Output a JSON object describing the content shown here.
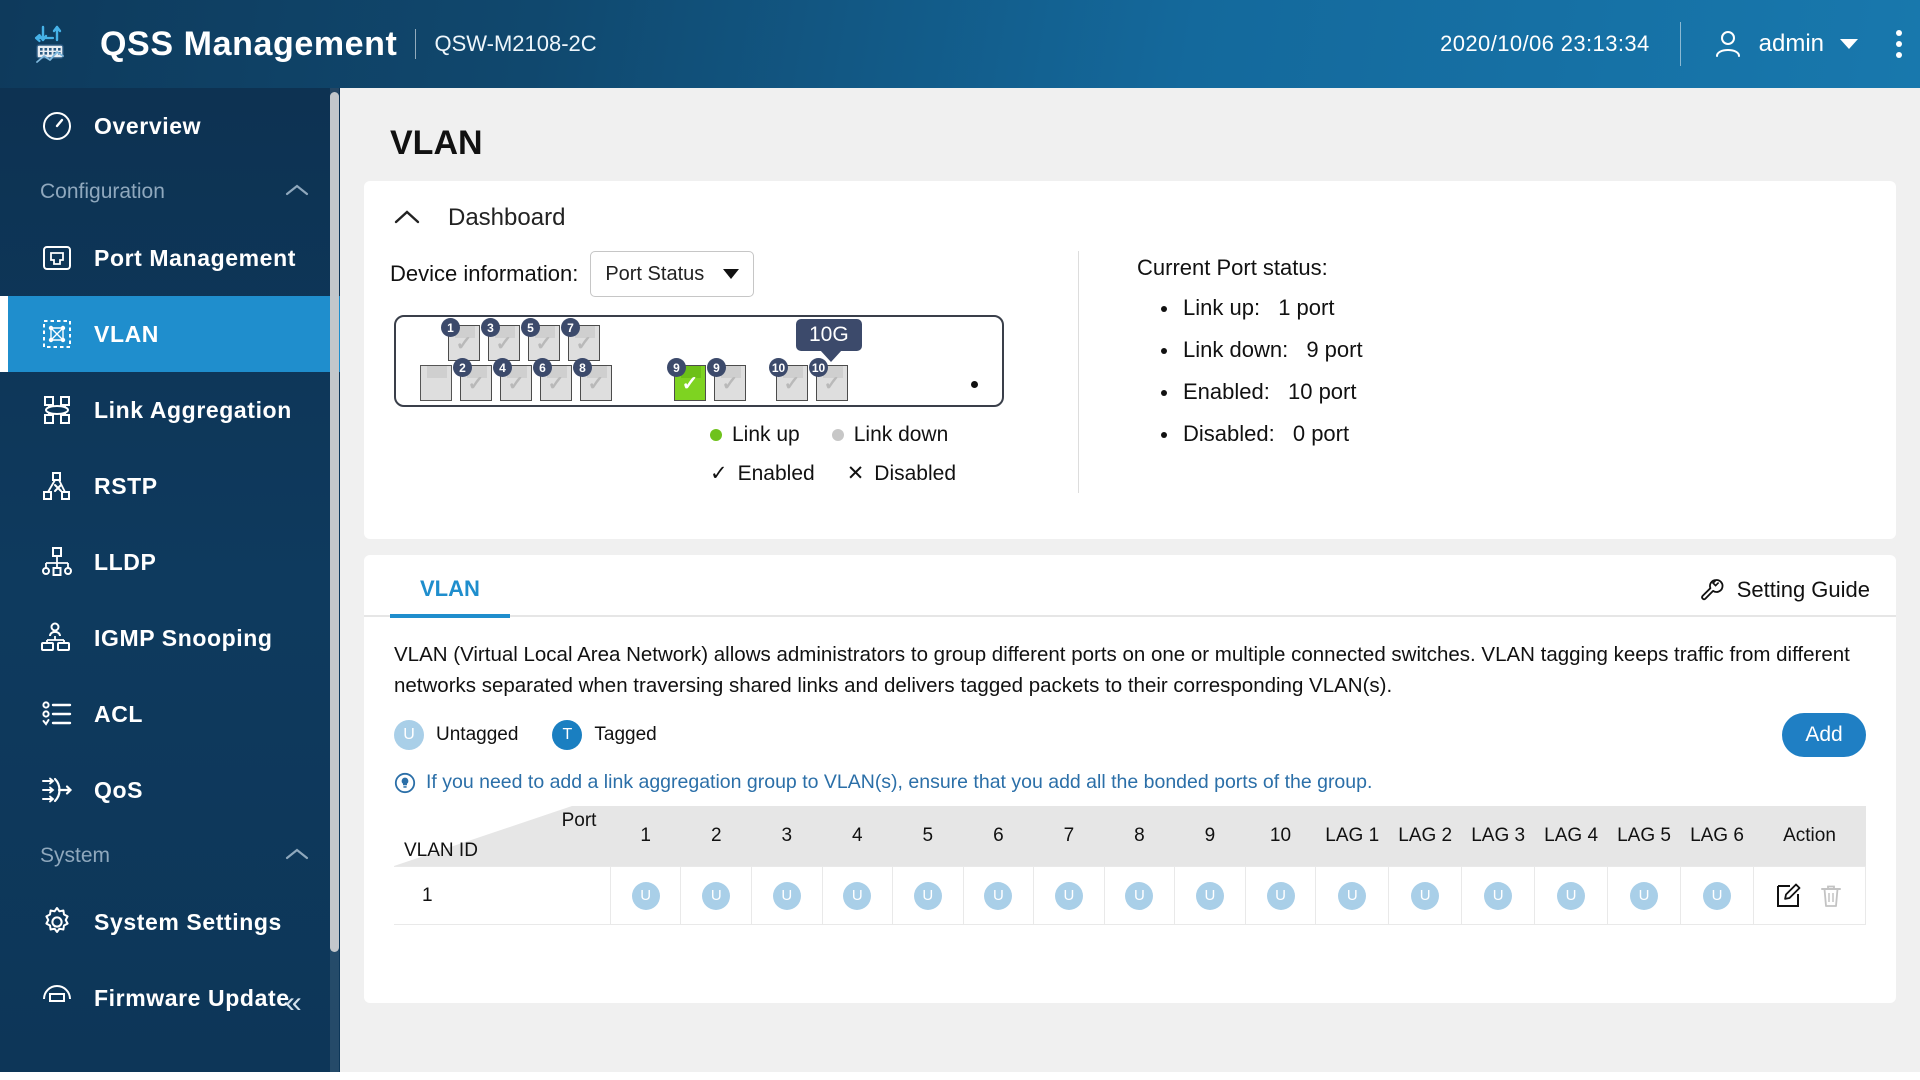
{
  "header": {
    "brand": "QSS Management",
    "model": "QSW-M2108-2C",
    "datetime": "2020/10/06 23:13:34",
    "username": "admin",
    "user_icon": "user-icon",
    "menu_icon": "kebab-menu-icon"
  },
  "sidebar": {
    "items": [
      {
        "label": "Overview",
        "icon": "speedometer-icon",
        "type": "item",
        "active": false
      },
      {
        "label": "Configuration",
        "icon": "chevron-up-icon",
        "type": "group"
      },
      {
        "label": "Port Management",
        "icon": "ethernet-port-icon",
        "type": "item",
        "active": false
      },
      {
        "label": "VLAN",
        "icon": "vlan-mesh-icon",
        "type": "item",
        "active": true
      },
      {
        "label": "Link Aggregation",
        "icon": "link-aggregation-icon",
        "type": "item",
        "active": false
      },
      {
        "label": "RSTP",
        "icon": "rstp-tree-icon",
        "type": "item",
        "active": false
      },
      {
        "label": "LLDP",
        "icon": "lldp-tree-icon",
        "type": "item",
        "active": false
      },
      {
        "label": "IGMP Snooping",
        "icon": "igmp-snooping-icon",
        "type": "item",
        "active": false
      },
      {
        "label": "ACL",
        "icon": "acl-list-icon",
        "type": "item",
        "active": false
      },
      {
        "label": "QoS",
        "icon": "qos-arrows-icon",
        "type": "item",
        "active": false
      },
      {
        "label": "System",
        "icon": "chevron-up-icon",
        "type": "group"
      },
      {
        "label": "System Settings",
        "icon": "gear-icon",
        "type": "item",
        "active": false
      },
      {
        "label": "Firmware Update",
        "icon": "firmware-update-icon",
        "type": "item",
        "active": false
      }
    ],
    "collapse_icon": "collapse-left-icon"
  },
  "page": {
    "title": "VLAN"
  },
  "dashboard": {
    "title": "Dashboard",
    "collapse_icon": "chevron-up-icon",
    "device_info_label": "Device information:",
    "device_info_value": "Port Status",
    "device_info_options": [
      "Port Status"
    ],
    "speed_tag": "10G",
    "ports_top": [
      {
        "num": "1",
        "state": "down",
        "enabled": true
      },
      {
        "num": "3",
        "state": "down",
        "enabled": true
      },
      {
        "num": "5",
        "state": "down",
        "enabled": true
      },
      {
        "num": "7",
        "state": "down",
        "enabled": true
      }
    ],
    "ports_bottom": [
      {
        "num": "",
        "state": "blank",
        "enabled": false
      },
      {
        "num": "2",
        "state": "down",
        "enabled": true
      },
      {
        "num": "4",
        "state": "down",
        "enabled": true
      },
      {
        "num": "6",
        "state": "down",
        "enabled": true
      },
      {
        "num": "8",
        "state": "down",
        "enabled": true
      }
    ],
    "ports_sfp": [
      {
        "num": "9",
        "state": "up",
        "enabled": true
      },
      {
        "num": "9",
        "state": "down",
        "enabled": true
      },
      {
        "num": "10",
        "state": "down",
        "enabled": true
      },
      {
        "num": "10",
        "state": "down",
        "enabled": true
      }
    ],
    "legend": {
      "link_up": "Link up",
      "link_down": "Link down",
      "enabled": "Enabled",
      "disabled": "Disabled",
      "enabled_mark": "✓",
      "disabled_mark": "✕"
    },
    "status": {
      "title": "Current Port status:",
      "rows": [
        {
          "label": "Link up:",
          "value": "1 port"
        },
        {
          "label": "Link down:",
          "value": "9 port"
        },
        {
          "label": "Enabled:",
          "value": "10 port"
        },
        {
          "label": "Disabled:",
          "value": "0 port"
        }
      ]
    }
  },
  "vlan_panel": {
    "tab_label": "VLAN",
    "setting_guide_label": "Setting Guide",
    "setting_guide_icon": "wrench-icon",
    "description": "VLAN (Virtual Local Area Network) allows administrators to group different ports on one or multiple connected switches. VLAN tagging keeps traffic from different networks separated when traversing shared links and delivers tagged packets to their corresponding VLAN(s).",
    "legend_untagged": "Untagged",
    "legend_tagged": "Tagged",
    "badge_untagged": "U",
    "badge_tagged": "T",
    "add_label": "Add",
    "hint_icon": "info-bulb-icon",
    "hint_text": "If you need to add a link aggregation group to VLAN(s), ensure that you add all the bonded ports of the group.",
    "table": {
      "corner_port_label": "Port",
      "corner_vlanid_label": "VLAN ID",
      "columns": [
        "1",
        "2",
        "3",
        "4",
        "5",
        "6",
        "7",
        "8",
        "9",
        "10",
        "LAG 1",
        "LAG 2",
        "LAG 3",
        "LAG 4",
        "LAG 5",
        "LAG 6"
      ],
      "action_label": "Action",
      "rows": [
        {
          "vlan_id": "1",
          "cells": [
            "U",
            "U",
            "U",
            "U",
            "U",
            "U",
            "U",
            "U",
            "U",
            "U",
            "U",
            "U",
            "U",
            "U",
            "U",
            "U"
          ],
          "edit_icon": "edit-pencil-icon",
          "delete_icon": "trash-icon"
        }
      ]
    }
  },
  "colors": {
    "accent": "#1f8ecd",
    "header_dark": "#0e3a5c",
    "sidebar": "#0d3252",
    "link_up": "#6fc21c",
    "link_down": "#c7c7c7",
    "untagged": "#a9cfe8",
    "tagged": "#1a7fc1",
    "tag_badge": "#3c4a6b",
    "add_button": "#1f7fc4",
    "hint_text": "#2b6fa8"
  }
}
